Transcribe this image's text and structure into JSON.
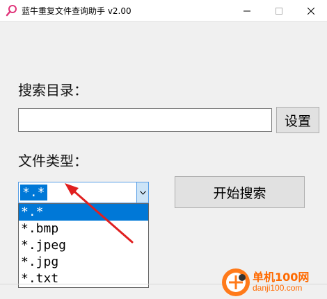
{
  "window": {
    "title": "蓝牛重复文件查询助手 v2.00",
    "icon": "magnifier-icon",
    "controls": [
      "minimize-icon",
      "maximize-icon",
      "close-icon"
    ]
  },
  "form": {
    "directory_label": "搜索目录：",
    "directory_value": "",
    "set_button": "设置",
    "type_label": "文件类型：",
    "type_selected": "*.*",
    "search_button": "开始搜索"
  },
  "dropdown": {
    "options": [
      "*.*",
      "*.bmp",
      "*.jpeg",
      "*.jpg",
      "*.txt"
    ],
    "selected_index": 0
  },
  "annotation": {
    "arrow_color": "#e02020"
  },
  "watermark": {
    "text": "单机100网",
    "url": "danji100.com",
    "color": "#ff6a00"
  },
  "colors": {
    "accent": "#0078d7"
  }
}
